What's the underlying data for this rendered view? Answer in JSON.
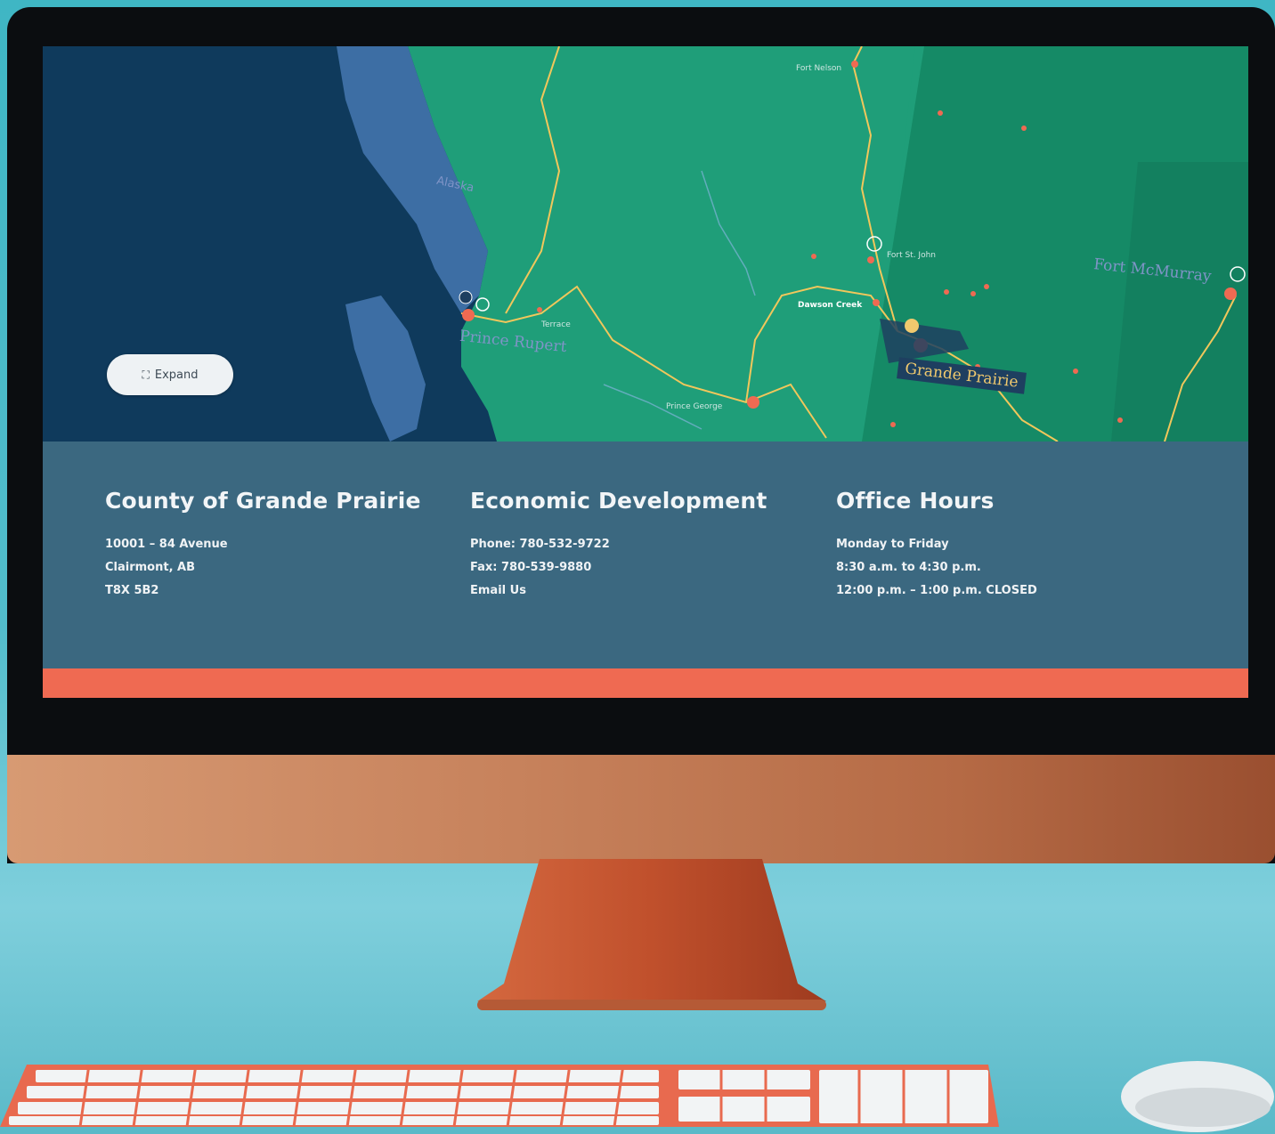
{
  "map": {
    "expand_label": "Expand",
    "labels": {
      "alaska": "Alaska",
      "prince_rupert": "Prince Rupert",
      "grande_prairie": "Grande Prairie",
      "fort_mcmurray": "Fort McMurray",
      "fort_nelson": "Fort Nelson",
      "fort_st_john": "Fort St. John",
      "dawson_creek": "Dawson Creek",
      "prince_george": "Prince George",
      "terrace": "Terrace"
    },
    "colors": {
      "ocean": "#0f3a5c",
      "bc_land": "#1f9e79",
      "alberta_land": "#15805f",
      "roads": "#f1c75b",
      "cities": "#ef6a52"
    }
  },
  "contact": {
    "county": {
      "title": "County of Grande Prairie",
      "lines": [
        "10001 – 84 Avenue",
        "Clairmont, AB",
        "T8X 5B2"
      ]
    },
    "economic": {
      "title": "Economic Development",
      "lines": [
        "Phone: 780-532-9722",
        "Fax: 780-539-9880",
        "Email Us"
      ]
    },
    "hours": {
      "title": "Office Hours",
      "lines": [
        "Monday to Friday",
        "8:30 a.m. to 4:30 p.m.",
        "12:00 p.m. – 1:00 p.m. CLOSED"
      ]
    }
  },
  "accent_color": "#ef6a52"
}
